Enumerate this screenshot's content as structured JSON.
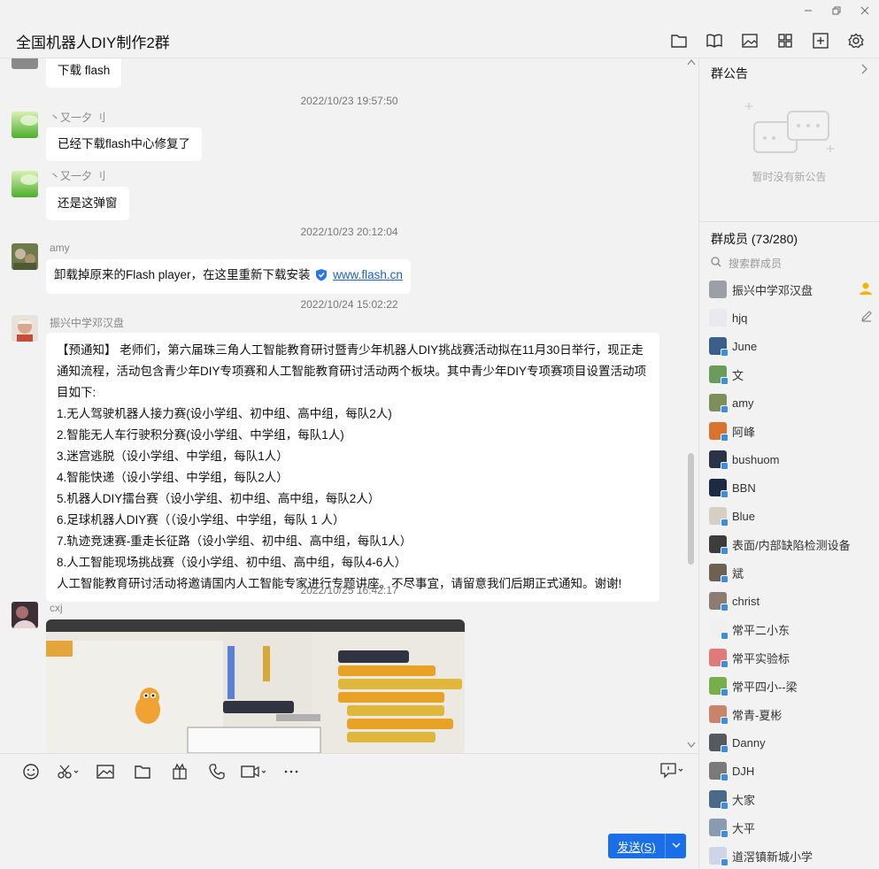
{
  "window": {
    "title": "全国机器人DIY制作2群",
    "controls": [
      "minimize-icon",
      "restore-icon",
      "close-icon"
    ],
    "header_tools": [
      "folder-icon",
      "book-icon",
      "image-icon",
      "apps-icon",
      "add-icon",
      "settings-icon"
    ]
  },
  "chat": {
    "messages": [
      {
        "type": "text",
        "text": "下载  flash"
      },
      {
        "type": "time",
        "text": "2022/10/23 19:57:50"
      },
      {
        "type": "text",
        "sender": "丶又一夕 刂",
        "text": "已经下载flash中心修复了"
      },
      {
        "type": "text",
        "sender": "丶又一夕 刂",
        "text": "还是这弹窗"
      },
      {
        "type": "time",
        "text": "2022/10/23 20:12:04"
      },
      {
        "type": "text",
        "sender": "amy",
        "text": "卸载掉原来的Flash player，在这里重新下载安装",
        "link": "www.flash.cn"
      },
      {
        "type": "time",
        "text": "2022/10/24 15:02:22"
      },
      {
        "type": "text",
        "sender": "振兴中学邓汉盘",
        "lines": [
          "【预通知】 老师们，第六届珠三角人工智能教育研讨暨青少年机器人DIY挑战赛活动拟在11月30日举行，现正走通知流程，活动包含青少年DIY专项赛和人工智能教育研讨活动两个板块。其中青少年DIY专项赛项目设置活动项目如下:",
          "1.无人驾驶机器人接力赛(设小学组、初中组、高中组，每队2人)",
          "2.智能无人车行驶积分赛(设小学组、中学组，每队1人)",
          "3.迷宫逃脱（设小学组、中学组，每队1人）",
          "4.智能快递（设小学组、中学组，每队2人）",
          "5.机器人DIY擂台赛（设小学组、初中组、高中组，每队2人）",
          "6.足球机器人DIY赛（（设小学组、中学组，每队 1 人）",
          "7.轨迹竞速赛-重走长征路（设小学组、初中组、高中组，每队1人）",
          "8.人工智能现场挑战赛（设小学组、初中组、高中组，每队4-6人）",
          "人工智能教育研讨活动将邀请国内人工智能专家进行专题讲座。不尽事宜，请留意我们后期正式通知。谢谢!"
        ]
      },
      {
        "type": "time",
        "text": "2022/10/25 16:42:17"
      },
      {
        "type": "image",
        "sender": "cxj"
      }
    ]
  },
  "input": {
    "tools": [
      "emoji-icon",
      "scissors-icon",
      "image-icon",
      "folder-icon",
      "gift-icon",
      "phone-icon",
      "video-icon",
      "more-icon"
    ],
    "send_label": "发送(S)"
  },
  "panel": {
    "notice_title": "群公告",
    "notice_empty": "暂时没有新公告",
    "members_title": "群成员 (73/280)",
    "search_placeholder": "搜索群成员",
    "members": [
      {
        "name": "振兴中学邓汉盘",
        "role": "owner-icon",
        "color": "#9aa0a6"
      },
      {
        "name": "hjq",
        "role": "edit-icon",
        "color": "#e8eaf0"
      },
      {
        "name": "June",
        "color": "#3b5f8a"
      },
      {
        "name": "文",
        "color": "#6a9c5a"
      },
      {
        "name": "amy",
        "color": "#7e8f5a"
      },
      {
        "name": "阿峰",
        "color": "#d9742c"
      },
      {
        "name": "bushuom",
        "color": "#2a3446"
      },
      {
        "name": "BBN",
        "color": "#1c2a44"
      },
      {
        "name": "Blue",
        "color": "#d6d0c4"
      },
      {
        "name": "表面/内部缺陷检测设备",
        "color": "#3c3c3c"
      },
      {
        "name": "斌",
        "color": "#6d6152"
      },
      {
        "name": "christ",
        "color": "#8c7c74"
      },
      {
        "name": "常平二小东",
        "color": "#f0f0f0"
      },
      {
        "name": "常平实验标",
        "color": "#e07a7a"
      },
      {
        "name": "常平四小--梁",
        "color": "#77b04a"
      },
      {
        "name": "常青-夏彬",
        "color": "#c9846a"
      },
      {
        "name": "Danny",
        "color": "#555a60"
      },
      {
        "name": "DJH",
        "color": "#7a7a7a"
      },
      {
        "name": "大家",
        "color": "#4a6a8a"
      },
      {
        "name": "大平",
        "color": "#8a9ab0"
      },
      {
        "name": "道滘镇新城小学",
        "color": "#d0d4e8"
      }
    ]
  }
}
